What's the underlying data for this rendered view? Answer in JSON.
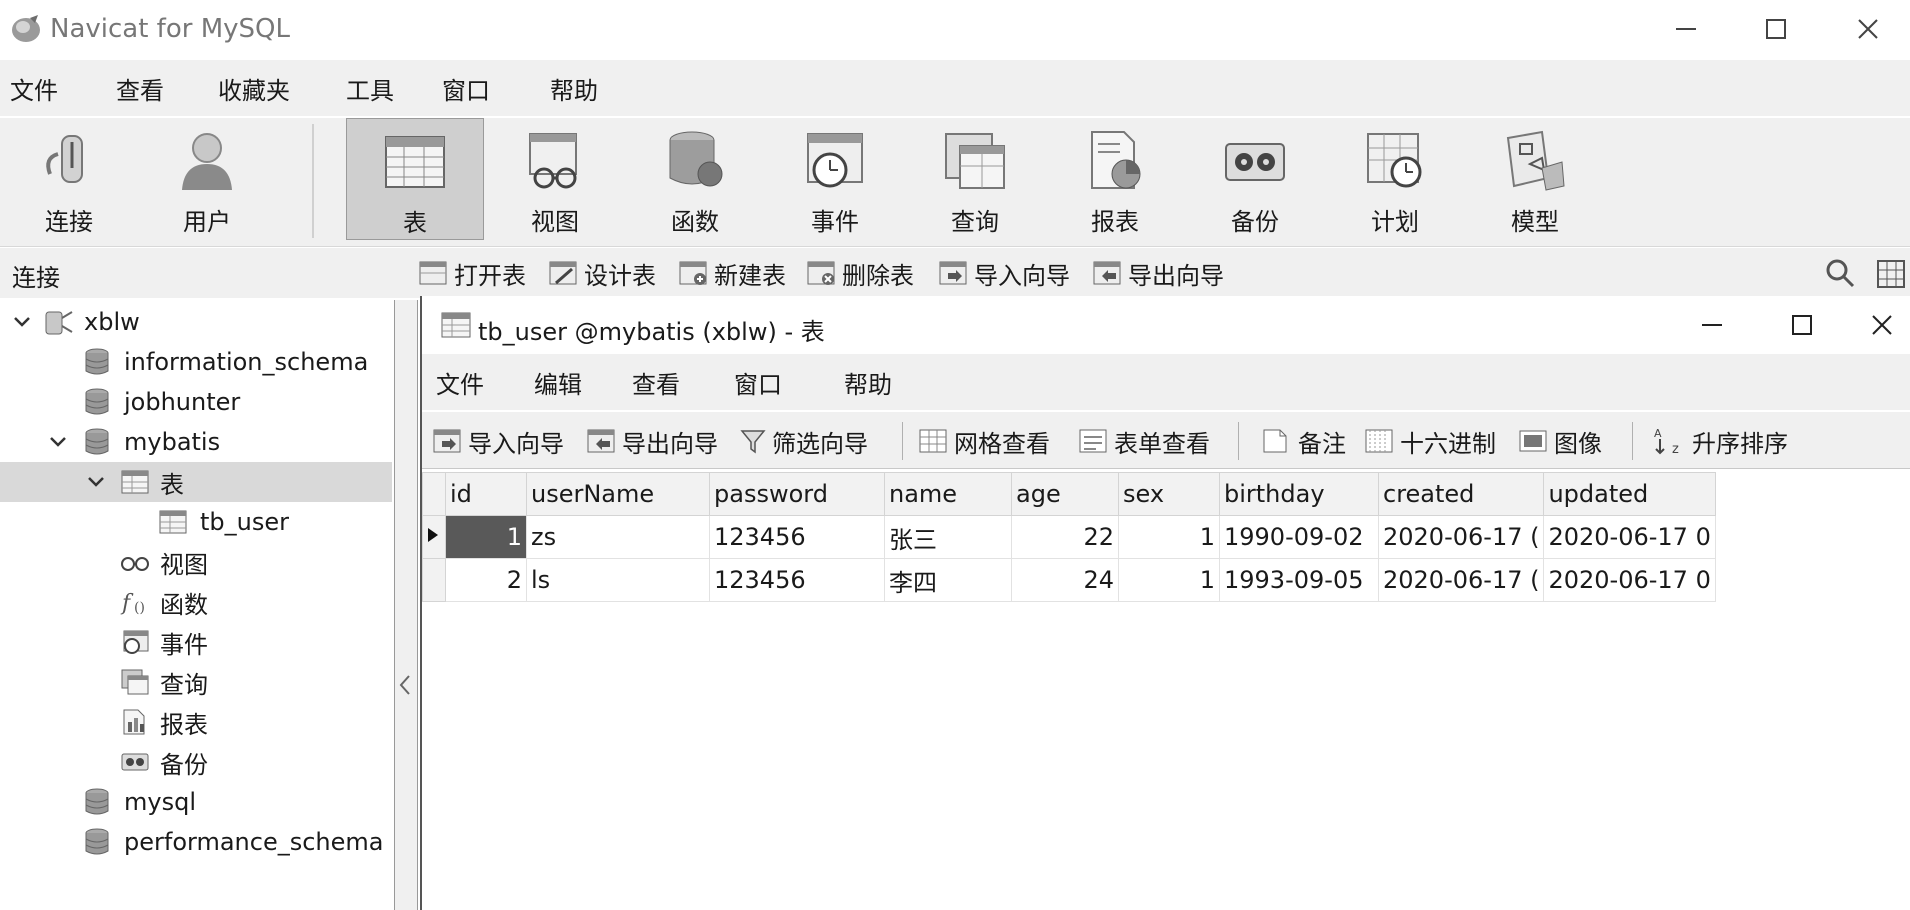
{
  "app": {
    "title": "Navicat for MySQL"
  },
  "menubar": [
    "文件",
    "查看",
    "收藏夹",
    "工具",
    "窗口",
    "帮助"
  ],
  "bigtoolbar": [
    "连接",
    "用户",
    "表",
    "视图",
    "函数",
    "事件",
    "查询",
    "报表",
    "备份",
    "计划",
    "模型"
  ],
  "subbar": {
    "connection_label": "连接",
    "actions": [
      "打开表",
      "设计表",
      "新建表",
      "删除表",
      "导入向导",
      "导出向导"
    ]
  },
  "tree": {
    "connection": "xblw",
    "databases": {
      "information_schema": "information_schema",
      "jobhunter": "jobhunter",
      "mybatis": "mybatis",
      "mysql": "mysql",
      "performance_schema": "performance_schema"
    },
    "mybatis_children": {
      "tables": "表",
      "tb_user": "tb_user",
      "views": "视图",
      "functions": "函数",
      "events": "事件",
      "queries": "查询",
      "reports": "报表",
      "backups": "备份"
    }
  },
  "inner": {
    "title": "tb_user @mybatis (xblw) - 表",
    "menubar": [
      "文件",
      "编辑",
      "查看",
      "窗口",
      "帮助"
    ],
    "toolbar": [
      "导入向导",
      "导出向导",
      "筛选向导",
      "网格查看",
      "表单查看",
      "备注",
      "十六进制",
      "图像",
      "升序排序"
    ]
  },
  "grid": {
    "columns": [
      "id",
      "userName",
      "password",
      "name",
      "age",
      "sex",
      "birthday",
      "created",
      "updated"
    ],
    "rows": [
      [
        "1",
        "zs",
        "123456",
        "张三",
        "22",
        "1",
        "1990-09-02",
        "2020-06-17 (",
        "2020-06-17 0"
      ],
      [
        "2",
        "ls",
        "123456",
        "李四",
        "24",
        "1",
        "1993-09-05",
        "2020-06-17 (",
        "2020-06-17 0"
      ]
    ]
  }
}
